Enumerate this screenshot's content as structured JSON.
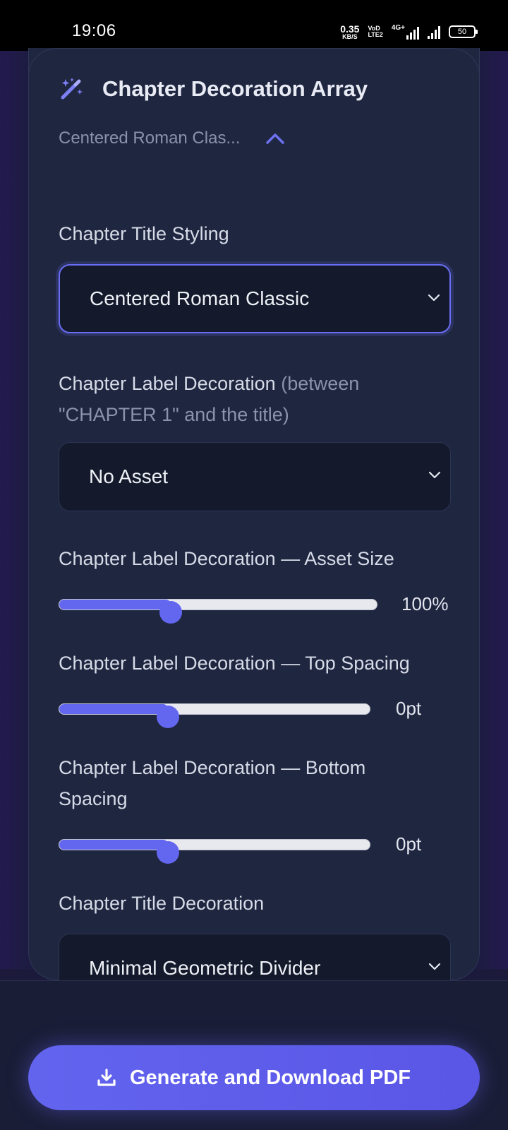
{
  "status_bar": {
    "time": "19:06",
    "net_speed": "0.35",
    "net_speed_unit": "KB/S",
    "volte_top": "VoD",
    "volte_bottom": "LTE2",
    "network_type": "4G+",
    "battery": "50"
  },
  "panel": {
    "title": "Chapter Decoration Array",
    "title_icon": "magic-wand-icon",
    "summary": "Centered Roman Clas...",
    "toggle_icon": "chevron-up-icon"
  },
  "fields": {
    "title_styling": {
      "label": "Chapter Title Styling",
      "value": "Centered Roman Classic"
    },
    "label_decoration": {
      "label": "Chapter Label Decoration",
      "label_sub": " (between",
      "label_sub2": "\"CHAPTER 1\" and the title)",
      "value": "No Asset"
    },
    "asset_size": {
      "label": "Chapter Label Decoration — Asset Size",
      "value_text": "100%",
      "fraction": 0.35
    },
    "top_spacing": {
      "label": "Chapter Label Decoration — Top Spacing",
      "value_text": "0pt",
      "fraction": 0.35
    },
    "bottom_spacing": {
      "label_line1": "Chapter Label Decoration — Bottom",
      "label_line2": "Spacing",
      "value_text": "0pt",
      "fraction": 0.35
    },
    "title_decoration": {
      "label": "Chapter Title Decoration",
      "value": "Minimal Geometric Divider"
    }
  },
  "actions": {
    "generate_label": "Generate and Download PDF",
    "generate_icon": "download-icon"
  },
  "colors": {
    "accent": "#6367f0",
    "card_bg": "#1f2640",
    "page_bg": "#1b1a3a"
  }
}
